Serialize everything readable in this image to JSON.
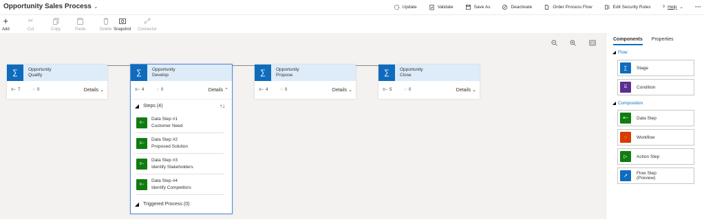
{
  "header": {
    "title": "Opportunity Sales Process",
    "commands": [
      {
        "label": "Update",
        "icon": "refresh-icon"
      },
      {
        "label": "Validate",
        "icon": "clipboard-check-icon"
      },
      {
        "label": "Save As",
        "icon": "save-as-icon"
      },
      {
        "label": "Deactivate",
        "icon": "deactivate-icon"
      },
      {
        "label": "Order Process Flow",
        "icon": "document-icon"
      },
      {
        "label": "Edit Security Roles",
        "icon": "security-roles-icon"
      },
      {
        "label": "Help",
        "icon": "help-icon"
      }
    ],
    "more": "···"
  },
  "toolbar": {
    "add": "Add",
    "cut": "Cut",
    "copy": "Copy",
    "paste": "Paste",
    "delete": "Delete",
    "snapshot": "Snapshot",
    "connector": "Connector"
  },
  "stages": [
    {
      "entity": "Opportunity",
      "name": "Qualify",
      "steps": "7",
      "workflows": "0",
      "details": "Details"
    },
    {
      "entity": "Opportunity",
      "name": "Develop",
      "steps": "4",
      "workflows": "0",
      "details": "Details"
    },
    {
      "entity": "Opportunity",
      "name": "Propose",
      "steps": "4",
      "workflows": "0",
      "details": "Details"
    },
    {
      "entity": "Opportunity",
      "name": "Close",
      "steps": "5",
      "workflows": "0",
      "details": "Details"
    }
  ],
  "steps_panel": {
    "heading": "Steps (4)",
    "sort": "↑↓",
    "items": [
      {
        "title": "Data Step #1",
        "field": "Customer Need"
      },
      {
        "title": "Data Step #2",
        "field": "Proposed Solution"
      },
      {
        "title": "Data Step #3",
        "field": "Identify Stakeholders"
      },
      {
        "title": "Data Step #4",
        "field": "Identify Competitors"
      }
    ],
    "triggered": "Triggered Process (0)"
  },
  "right_panel": {
    "tabs": [
      "Components",
      "Properties"
    ],
    "flow_section": "Flow",
    "composition_section": "Composition",
    "flow_items": [
      {
        "label": "Stage",
        "icon": "stage-icon",
        "color": "#0f6cbd"
      },
      {
        "label": "Condition",
        "icon": "condition-icon",
        "color": "#5c2e91"
      }
    ],
    "composition_items": [
      {
        "label": "Data Step",
        "icon": "data-step-icon",
        "color": "#107c10"
      },
      {
        "label": "Workflow",
        "icon": "workflow-icon",
        "color": "#d83b01"
      },
      {
        "label": "Action Step",
        "icon": "action-step-icon",
        "color": "#107c10"
      },
      {
        "label": "Flow Step",
        "label2": "(Preview)",
        "icon": "flow-step-icon",
        "color": "#0f6cbd"
      }
    ]
  }
}
